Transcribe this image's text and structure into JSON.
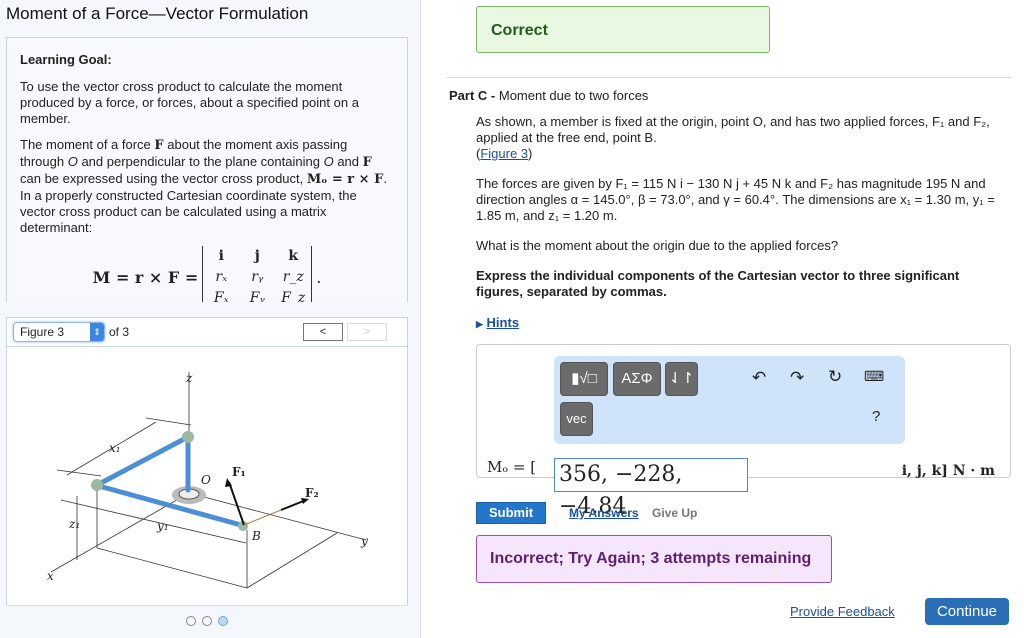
{
  "title": "Moment of a Force—Vector Formulation",
  "learning_goal": {
    "heading": "Learning Goal:",
    "p1": "To use the vector cross product to calculate the moment produced by a force, or forces, about a specified point on a member.",
    "p2a": "The moment of a force ",
    "F": "F",
    "p2b": " about the moment axis passing through ",
    "O": "O",
    "p2c": " and perpendicular to the plane containing ",
    "p2d": " and ",
    "p2e": " can be expressed using the vector cross product, ",
    "mo_eq": "Mₒ = r × F",
    "p2f": ". In a properly constructed Cartesian coordinate system, the vector cross product can be calculated using a matrix determinant:",
    "det_lhs": "M = r × F =",
    "matrix": [
      "i",
      "j",
      "k",
      "rₓ",
      "rᵧ",
      "r_z",
      "Fₓ",
      "Fᵧ",
      "F_z"
    ]
  },
  "figure_nav": {
    "selected": "Figure 3",
    "of": "of 3",
    "prev": "<",
    "next": ">",
    "pages": 3,
    "current": 3
  },
  "figure_labels": {
    "z": "z",
    "x": "x",
    "y": "y",
    "x1": "x₁",
    "y1": "y₁",
    "z1": "z₁",
    "O": "O",
    "B": "B",
    "F1": "F₁",
    "F2": "F₂"
  },
  "colors": {
    "member": "#4d8fd6",
    "correct_bg": "#e9f9e1",
    "incorrect_bg": "#f5e6fb",
    "submit": "#2277cc"
  },
  "status_correct": "Correct",
  "part": {
    "label": "Part C",
    "sep": " - ",
    "title": "Moment due to two forces"
  },
  "question": {
    "p1": "As shown, a member is fixed at the origin, point O, and has two applied forces, F₁ and F₂, applied at the free end, point B.",
    "fig_link": "Figure 3",
    "p2": "The forces are given by F₁ = 115 N i − 130 N j + 45 N k and F₂ has magnitude 195 N and direction angles α = 145.0°, β = 73.0°, and γ = 60.4°. The dimensions are x₁ = 1.30 m, y₁ = 1.85 m, and z₁ = 1.20 m.",
    "p3": "What is the moment about the origin due to the applied forces?",
    "p4": "Express the individual components of the Cartesian vector to three significant figures, separated by commas."
  },
  "hints": "Hints",
  "toolbar": {
    "templates": "▮√□",
    "greek": "ΑΣΦ",
    "arrows": "⇃↾",
    "vec": "vec",
    "help": "?"
  },
  "answer": {
    "label": "Mₒ = [",
    "value": "356, −228, −4.84",
    "units": "i, j, k] N · m"
  },
  "buttons": {
    "submit": "Submit",
    "my_answers": "My Answers",
    "give_up": "Give Up",
    "feedback": "Provide Feedback",
    "continue": "Continue"
  },
  "status_incorrect": "Incorrect; Try Again; 3 attempts remaining"
}
